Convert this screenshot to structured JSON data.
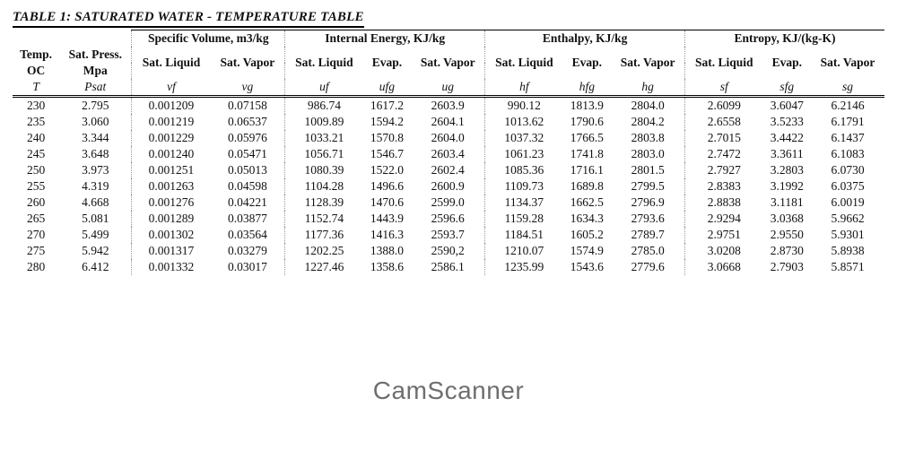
{
  "title": "TABLE 1: SATURATED WATER - TEMPERATURE TABLE",
  "groups": {
    "sv": "Specific Volume, m3/kg",
    "ie": "Internal Energy, KJ/kg",
    "en": "Enthalpy, KJ/kg",
    "se": "Entropy, KJ/(kg-K)"
  },
  "cols": {
    "temp": {
      "h1": "Temp.",
      "h2": "OC",
      "sym": "T"
    },
    "psat": {
      "h1": "Sat. Press.",
      "h2": "Mpa",
      "sym": "Psat"
    },
    "vf": {
      "h1": "Sat. Liquid",
      "sym": "vf"
    },
    "vg": {
      "h1": "Sat. Vapor",
      "sym": "vg"
    },
    "uf": {
      "h1": "Sat. Liquid",
      "sym": "uf"
    },
    "ufg": {
      "h1": "Evap.",
      "sym": "ufg"
    },
    "ug": {
      "h1": "Sat. Vapor",
      "sym": "ug"
    },
    "hf": {
      "h1": "Sat. Liquid",
      "sym": "hf"
    },
    "hfg": {
      "h1": "Evap.",
      "sym": "hfg"
    },
    "hg": {
      "h1": "Sat. Vapor",
      "sym": "hg"
    },
    "sf": {
      "h1": "Sat. Liquid",
      "sym": "sf"
    },
    "sfg": {
      "h1": "Evap.",
      "sym": "sfg"
    },
    "sg": {
      "h1": "Sat. Vapor",
      "sym": "sg"
    }
  },
  "chart_data": {
    "type": "table",
    "rows": [
      {
        "T": "230",
        "Psat": "2.795",
        "vf": "0.001209",
        "vg": "0.07158",
        "uf": "986.74",
        "ufg": "1617.2",
        "ug": "2603.9",
        "hf": "990.12",
        "hfg": "1813.9",
        "hg": "2804.0",
        "sf": "2.6099",
        "sfg": "3.6047",
        "sg": "6.2146"
      },
      {
        "T": "235",
        "Psat": "3.060",
        "vf": "0.001219",
        "vg": "0.06537",
        "uf": "1009.89",
        "ufg": "1594.2",
        "ug": "2604.1",
        "hf": "1013.62",
        "hfg": "1790.6",
        "hg": "2804.2",
        "sf": "2.6558",
        "sfg": "3.5233",
        "sg": "6.1791"
      },
      {
        "T": "240",
        "Psat": "3.344",
        "vf": "0.001229",
        "vg": "0.05976",
        "uf": "1033.21",
        "ufg": "1570.8",
        "ug": "2604.0",
        "hf": "1037.32",
        "hfg": "1766.5",
        "hg": "2803.8",
        "sf": "2.7015",
        "sfg": "3.4422",
        "sg": "6.1437"
      },
      {
        "T": "245",
        "Psat": "3.648",
        "vf": "0.001240",
        "vg": "0.05471",
        "uf": "1056.71",
        "ufg": "1546.7",
        "ug": "2603.4",
        "hf": "1061.23",
        "hfg": "1741.8",
        "hg": "2803.0",
        "sf": "2.7472",
        "sfg": "3.3611",
        "sg": "6.1083"
      },
      {
        "T": "250",
        "Psat": "3.973",
        "vf": "0.001251",
        "vg": "0.05013",
        "uf": "1080.39",
        "ufg": "1522.0",
        "ug": "2602.4",
        "hf": "1085.36",
        "hfg": "1716.1",
        "hg": "2801.5",
        "sf": "2.7927",
        "sfg": "3.2803",
        "sg": "6.0730"
      },
      {
        "T": "255",
        "Psat": "4.319",
        "vf": "0.001263",
        "vg": "0.04598",
        "uf": "1104.28",
        "ufg": "1496.6",
        "ug": "2600.9",
        "hf": "1109.73",
        "hfg": "1689.8",
        "hg": "2799.5",
        "sf": "2.8383",
        "sfg": "3.1992",
        "sg": "6.0375"
      },
      {
        "T": "260",
        "Psat": "4.668",
        "vf": "0.001276",
        "vg": "0.04221",
        "uf": "1128.39",
        "ufg": "1470.6",
        "ug": "2599.0",
        "hf": "1134.37",
        "hfg": "1662.5",
        "hg": "2796.9",
        "sf": "2.8838",
        "sfg": "3.1181",
        "sg": "6.0019"
      },
      {
        "T": "265",
        "Psat": "5.081",
        "vf": "0.001289",
        "vg": "0.03877",
        "uf": "1152.74",
        "ufg": "1443.9",
        "ug": "2596.6",
        "hf": "1159.28",
        "hfg": "1634.3",
        "hg": "2793.6",
        "sf": "2.9294",
        "sfg": "3.0368",
        "sg": "5.9662"
      },
      {
        "T": "270",
        "Psat": "5.499",
        "vf": "0.001302",
        "vg": "0.03564",
        "uf": "1177.36",
        "ufg": "1416.3",
        "ug": "2593.7",
        "hf": "1184.51",
        "hfg": "1605.2",
        "hg": "2789.7",
        "sf": "2.9751",
        "sfg": "2.9550",
        "sg": "5.9301"
      },
      {
        "T": "275",
        "Psat": "5.942",
        "vf": "0.001317",
        "vg": "0.03279",
        "uf": "1202.25",
        "ufg": "1388.0",
        "ug": "2590,2",
        "hf": "1210.07",
        "hfg": "1574.9",
        "hg": "2785.0",
        "sf": "3.0208",
        "sfg": "2.8730",
        "sg": "5.8938"
      },
      {
        "T": "280",
        "Psat": "6.412",
        "vf": "0.001332",
        "vg": "0.03017",
        "uf": "1227.46",
        "ufg": "1358.6",
        "ug": "2586.1",
        "hf": "1235.99",
        "hfg": "1543.6",
        "hg": "2779.6",
        "sf": "3.0668",
        "sfg": "2.7903",
        "sg": "5.8571"
      }
    ]
  },
  "watermark": "CamScanner"
}
